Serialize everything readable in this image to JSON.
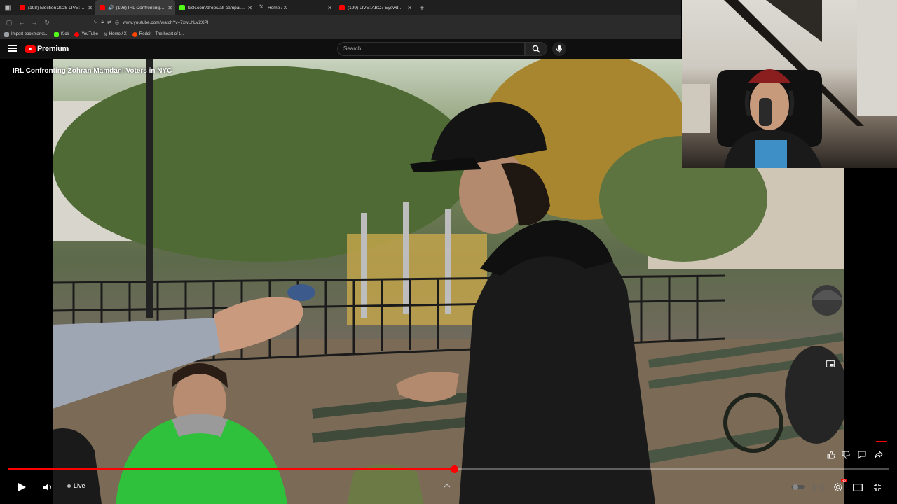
{
  "browser": {
    "tabs": [
      {
        "title": "(198) Election 2025 LIVE: Result",
        "favicon_color": "#ff0000",
        "active": false
      },
      {
        "title": "(198) IRL Confronting Zohr",
        "favicon_color": "#ff0000",
        "active": true
      },
      {
        "title": "kick.com/drops/all-campaigns",
        "favicon_color": "#53fc18",
        "active": false
      },
      {
        "title": "Home / X",
        "favicon_color": "#ffffff",
        "active": false
      },
      {
        "title": "(199) LIVE: ABC7 Eyewitness N",
        "favicon_color": "#ff0000",
        "active": false
      }
    ],
    "url": "www.youtube.com/watch?v=7xwLhLV2XPI",
    "bookmarks": [
      {
        "label": "Import bookmarks...",
        "color": "#9aa0a6"
      },
      {
        "label": "Kick",
        "color": "#53fc18"
      },
      {
        "label": "YouTube",
        "color": "#ff0000"
      },
      {
        "label": "Home / X",
        "color": "#ffffff"
      },
      {
        "label": "Reddit - The heart of t...",
        "color": "#ff4500"
      }
    ]
  },
  "youtube": {
    "brand": "Premium",
    "search_placeholder": "Search",
    "video_title": "IRL Confronting Zohran Mamdani Voters in NYC",
    "live_label": "Live",
    "progress_fraction": 0.507,
    "hd_label": "HD"
  },
  "colors": {
    "accent": "#ff0000"
  }
}
